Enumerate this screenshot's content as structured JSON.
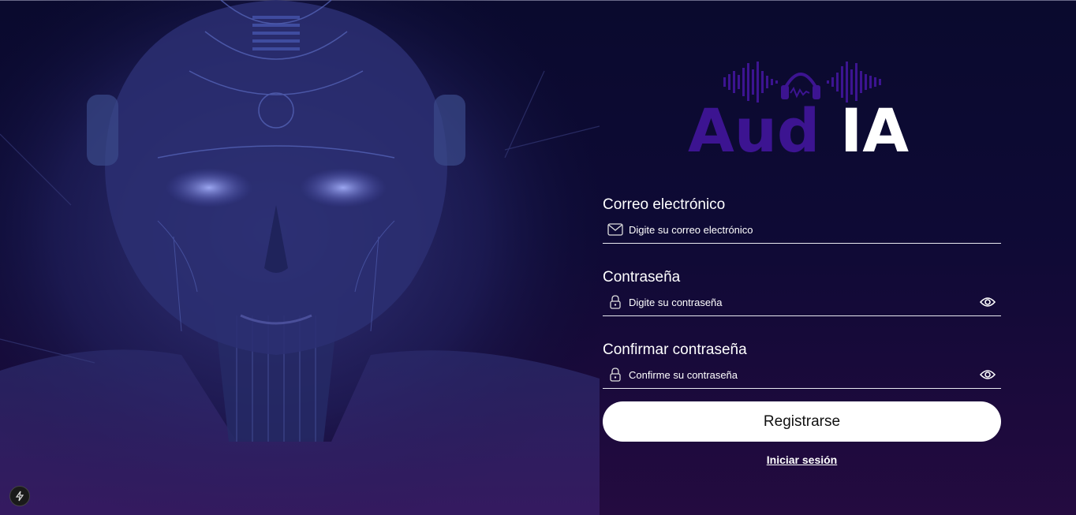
{
  "brand": {
    "logo_part1": "Aud",
    "logo_part2": "IA",
    "accent": "#3c1491"
  },
  "form": {
    "email": {
      "label": "Correo electrónico",
      "placeholder": "Digite su correo electrónico",
      "icon": "mail-icon"
    },
    "password": {
      "label": "Contraseña",
      "placeholder": "Digite su contraseña",
      "icon": "lock-icon"
    },
    "confirm": {
      "label": "Confirmar contraseña",
      "placeholder": "Confirme su contraseña",
      "icon": "lock-icon"
    }
  },
  "actions": {
    "register_label": "Registrarse",
    "login_link": "Iniciar sesión"
  },
  "colors": {
    "background_top": "#0a0a2e",
    "background_bottom": "#240b40",
    "text": "#ffffff",
    "button_bg": "#ffffff"
  }
}
